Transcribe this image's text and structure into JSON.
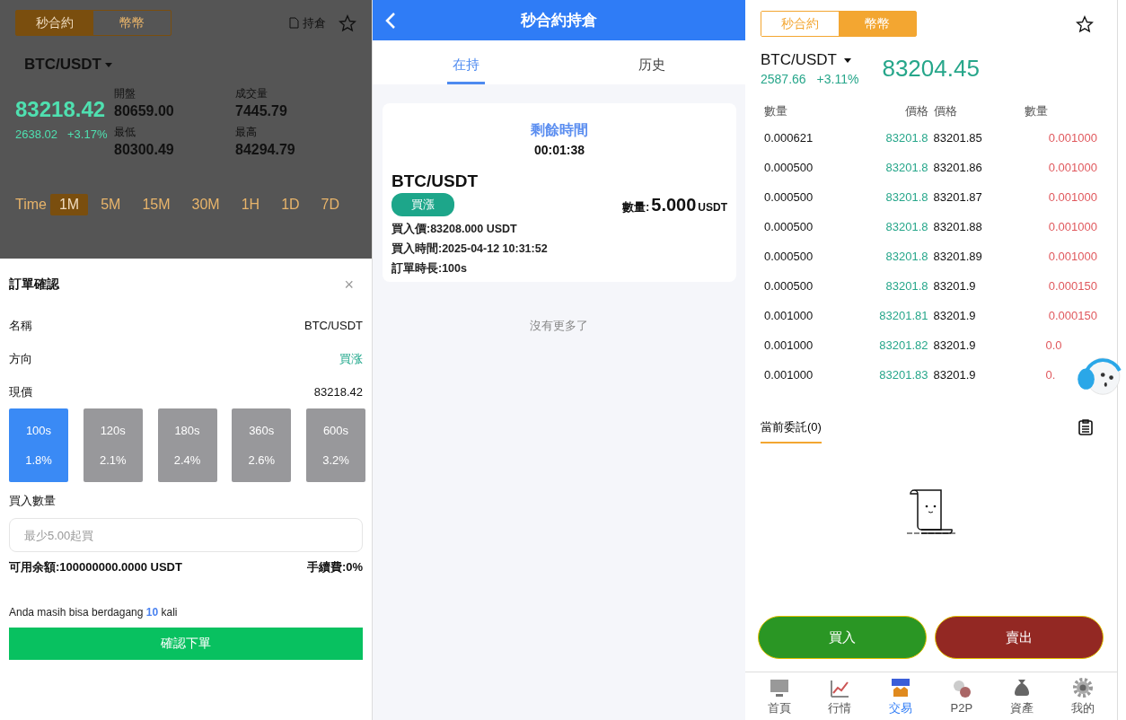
{
  "contract_page": {
    "mode_tabs": [
      {
        "label": "秒合約",
        "selected": true
      },
      {
        "label": "幣幣",
        "selected": false
      }
    ],
    "positions_link": "持倉",
    "pair": "BTC/USDT",
    "price": "83218.42",
    "change": "2638.02",
    "change_pct": "+3.17%",
    "stats": [
      {
        "label": "開盤",
        "value": "80659.00"
      },
      {
        "label": "成交量",
        "value": "7445.79"
      },
      {
        "label": "最低",
        "value": "80300.49"
      },
      {
        "label": "最高",
        "value": "84294.79"
      }
    ],
    "interval_label": "Time",
    "intervals": [
      {
        "label": "1M",
        "selected": true
      },
      {
        "label": "5M",
        "selected": false
      },
      {
        "label": "15M",
        "selected": false
      },
      {
        "label": "30M",
        "selected": false
      },
      {
        "label": "1H",
        "selected": false
      },
      {
        "label": "1D",
        "selected": false
      },
      {
        "label": "7D",
        "selected": false
      }
    ]
  },
  "order_sheet": {
    "title": "訂單確認",
    "close": "×",
    "rows": [
      {
        "label": "名稱",
        "value": "BTC/USDT",
        "kind": "plain"
      },
      {
        "label": "方向",
        "value": "買涨",
        "kind": "direction"
      },
      {
        "label": "現價",
        "value": "83218.42",
        "kind": "plain"
      }
    ],
    "durations": [
      {
        "time": "100s",
        "rate": "1.8%",
        "selected": true
      },
      {
        "time": "120s",
        "rate": "2.1%",
        "selected": false
      },
      {
        "time": "180s",
        "rate": "2.4%",
        "selected": false
      },
      {
        "time": "360s",
        "rate": "2.6%",
        "selected": false
      },
      {
        "time": "600s",
        "rate": "3.2%",
        "selected": false
      }
    ],
    "amount_label": "買入數量",
    "amount_placeholder": "最少5.00起買",
    "balance": "可用余額:100000000.0000 USDT",
    "fee": "手續費:0%",
    "note": "Anda masih bisa berdagang **10** kali",
    "confirm": "確認下單"
  },
  "positions_page": {
    "title": "秒合約持倉",
    "tabs": [
      {
        "label": "在持",
        "selected": true
      },
      {
        "label": "历史",
        "selected": false
      }
    ],
    "card": {
      "remaining_label": "剩餘時間",
      "countdown": "00:01:38",
      "pair": "BTC/USDT",
      "direction": "買漲",
      "quantity_label": "數量:",
      "quantity": "5.000",
      "quantity_unit": "USDT",
      "details": [
        "買入價:83208.000 USDT",
        "買入時間:2025-04-12 10:31:52",
        "訂單時長:100s"
      ]
    },
    "end_note": "沒有更多了"
  },
  "spot_page": {
    "mode_tabs": [
      {
        "label": "秒合約",
        "selected": false
      },
      {
        "label": "幣幣",
        "selected": true
      }
    ],
    "pair": "BTC/USDT",
    "change": "2587.66",
    "change_pct": "+3.11%",
    "price": "83204.45",
    "book_headers": [
      "數量",
      "價格",
      "價格",
      "數量"
    ],
    "book_rows": [
      {
        "bid_qty": "0.000621",
        "bid_price": "83201.8",
        "ask_price": "83201.85",
        "ask_qty": "0.001000"
      },
      {
        "bid_qty": "0.000500",
        "bid_price": "83201.8",
        "ask_price": "83201.86",
        "ask_qty": "0.001000"
      },
      {
        "bid_qty": "0.000500",
        "bid_price": "83201.8",
        "ask_price": "83201.87",
        "ask_qty": "0.001000"
      },
      {
        "bid_qty": "0.000500",
        "bid_price": "83201.8",
        "ask_price": "83201.88",
        "ask_qty": "0.001000"
      },
      {
        "bid_qty": "0.000500",
        "bid_price": "83201.8",
        "ask_price": "83201.89",
        "ask_qty": "0.001000"
      },
      {
        "bid_qty": "0.000500",
        "bid_price": "83201.8",
        "ask_price": "83201.9",
        "ask_qty": "0.000150"
      },
      {
        "bid_qty": "0.001000",
        "bid_price": "83201.81",
        "ask_price": "83201.9",
        "ask_qty": "0.000150"
      },
      {
        "bid_qty": "0.001000",
        "bid_price": "83201.82",
        "ask_price": "83201.9",
        "ask_qty": "0.0"
      },
      {
        "bid_qty": "0.001000",
        "bid_price": "83201.83",
        "ask_price": "83201.9",
        "ask_qty": "0."
      }
    ],
    "orders_tab": {
      "label": "當前委託(0)",
      "selected": true
    },
    "buy": "買入",
    "sell": "賣出",
    "nav": [
      {
        "label": "首頁",
        "selected": false
      },
      {
        "label": "行情",
        "selected": false
      },
      {
        "label": "交易",
        "selected": true
      },
      {
        "label": "P2P",
        "selected": false
      },
      {
        "label": "資產",
        "selected": false
      },
      {
        "label": "我的",
        "selected": false
      }
    ]
  }
}
